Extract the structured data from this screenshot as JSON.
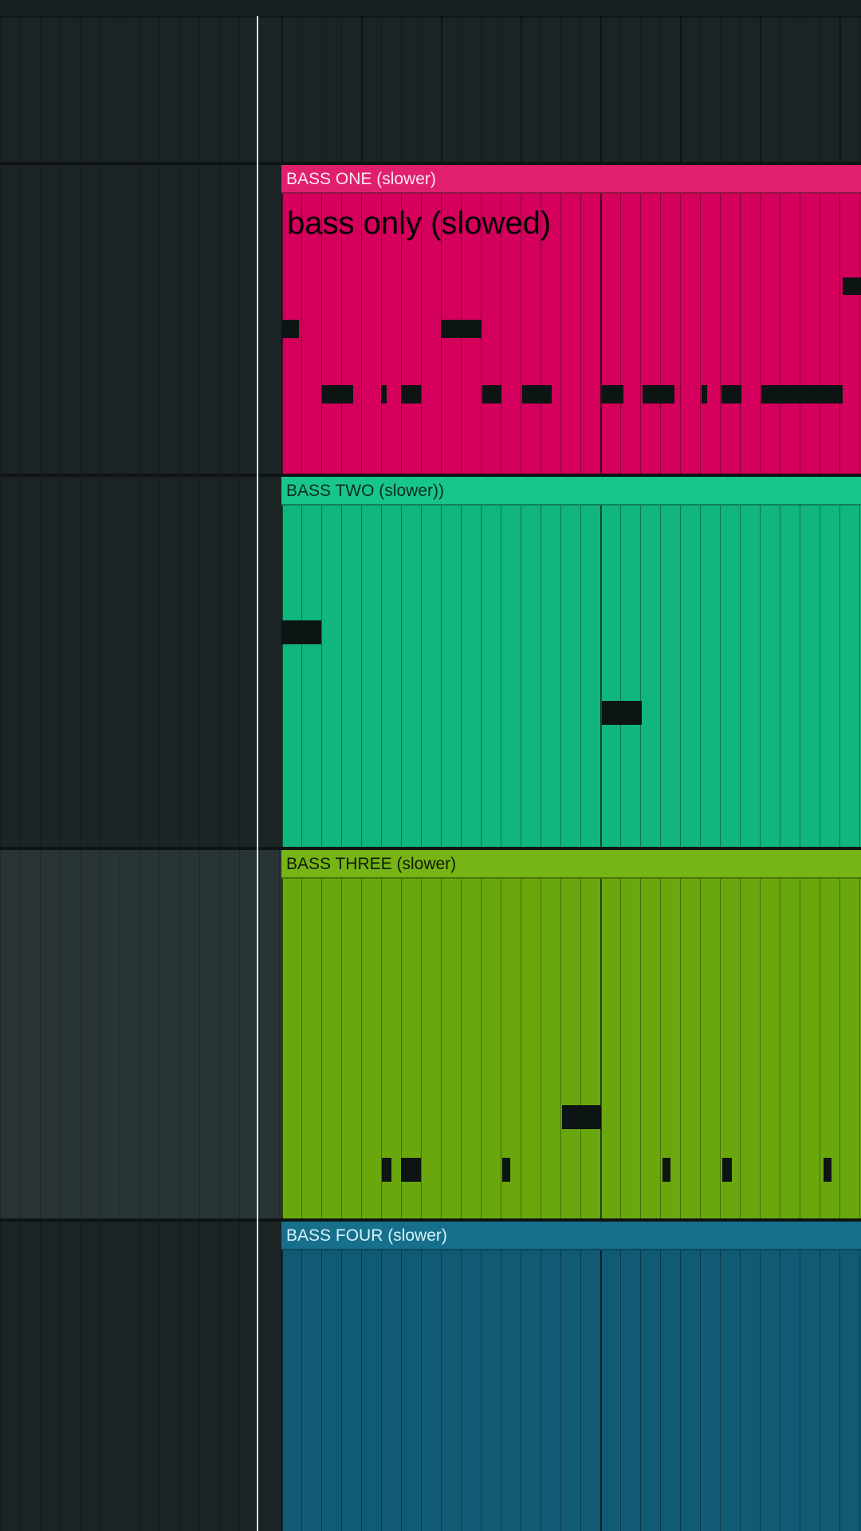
{
  "overlay_caption": "bass only (slowed)",
  "colors": {
    "background": "#1c2325",
    "highlight_lane": "#283436",
    "playhead": "#bfeadb",
    "note": "#0d1414"
  },
  "clips": [
    {
      "title": "BASS ONE (slower)",
      "color": "#d4005b",
      "header_color": "#e0206e",
      "title_color": "#ffe6ee"
    },
    {
      "title": "BASS TWO (slower))",
      "color": "#10b67b",
      "header_color": "#18c68a",
      "title_color": "#0b2b22"
    },
    {
      "title": "BASS THREE (slower)",
      "color": "#6aa70d",
      "header_color": "#76b515",
      "title_color": "#0f1a06"
    },
    {
      "title": "BASS FOUR (slower)",
      "color": "#115a73",
      "header_color": "#16708b",
      "title_color": "#d6f2fb"
    }
  ]
}
